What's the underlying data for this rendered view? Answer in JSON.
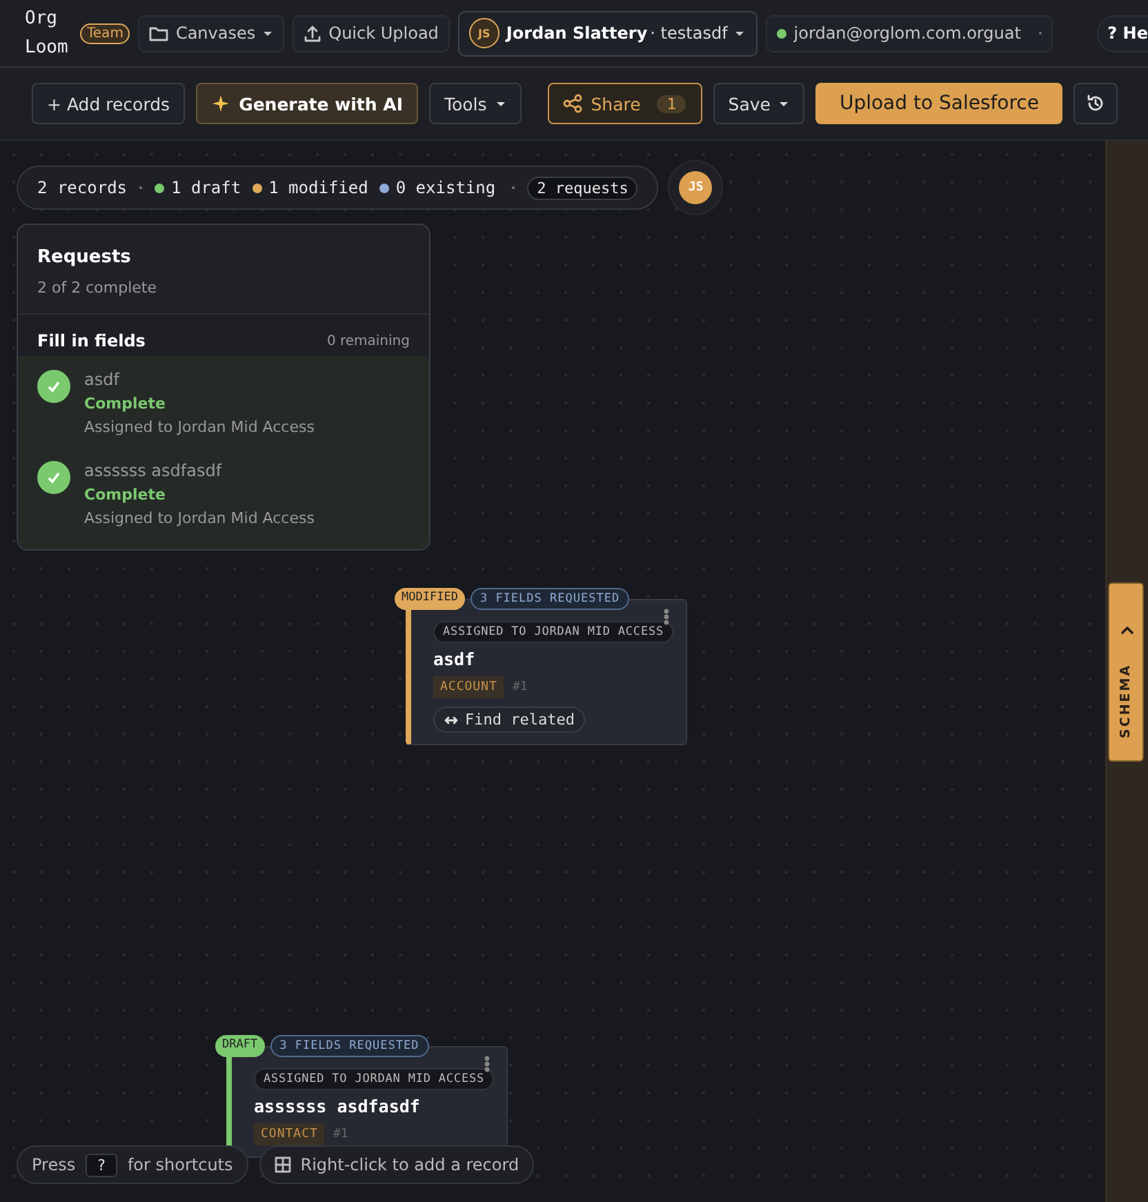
{
  "topbar": {
    "logo": "Org Loom",
    "badge": "Team",
    "canvases": "Canvases",
    "quick_upload": "Quick Upload",
    "account": {
      "initials": "JS",
      "name": "Jordan Slattery",
      "suffix": "· testasdf"
    },
    "org": {
      "label": "jordan@orglom.com.orguat",
      "color": "#7bc96f"
    },
    "help": "? He"
  },
  "toolbar": {
    "add": "+ Add records",
    "generate": "Generate with AI",
    "tools": "Tools",
    "share": "Share",
    "share_count": "1",
    "save": "Save",
    "upload": "Upload to Salesforce"
  },
  "summary": {
    "records": "2 records",
    "legend": [
      {
        "label": "1 draft",
        "color": "#7bc96f"
      },
      {
        "label": "1 modified",
        "color": "#e0a85a"
      },
      {
        "label": "0 existing",
        "color": "#8fa9d6"
      }
    ],
    "requests": "2 requests",
    "avatar": "JS"
  },
  "requests_panel": {
    "title": "Requests",
    "subtitle": "2 of 2 complete",
    "section": "Fill in fields",
    "remaining": "0 remaining",
    "items": [
      {
        "name": "asdf",
        "status": "Complete",
        "checked": true,
        "assignee": "Assigned to Jordan Mid Access"
      },
      {
        "name": "assssss asdfasdf",
        "status": "Complete",
        "checked": true,
        "assignee": "Assigned to Jordan Mid Access"
      }
    ]
  },
  "records": [
    {
      "kind": "modified",
      "status": "MODIFIED",
      "fields": "3 FIELDS REQUESTED",
      "assigned": "ASSIGNED TO JORDAN MID ACCESS",
      "title": "asdf",
      "type": "ACCOUNT",
      "number": "#1",
      "action": "Find related"
    },
    {
      "kind": "draft",
      "status": "DRAFT",
      "fields": "3 FIELDS REQUESTED",
      "assigned": "ASSIGNED TO JORDAN MID ACCESS",
      "title": "assssss asdfasdf",
      "type": "CONTACT",
      "number": "#1"
    }
  ],
  "schema_tab": "SCHEMA",
  "hints": {
    "press": "Press",
    "key": "?",
    "shortcuts": "for shortcuts",
    "add": "Right-click to add a record"
  }
}
